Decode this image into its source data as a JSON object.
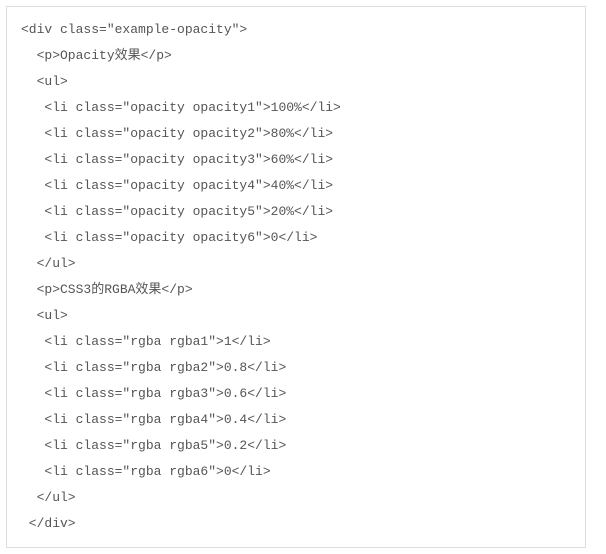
{
  "code": {
    "lines": [
      "<div class=\"example-opacity\">",
      "  <p>Opacity效果</p>",
      "  <ul>",
      "   <li class=\"opacity opacity1\">100%</li>",
      "   <li class=\"opacity opacity2\">80%</li>",
      "   <li class=\"opacity opacity3\">60%</li>",
      "   <li class=\"opacity opacity4\">40%</li>",
      "   <li class=\"opacity opacity5\">20%</li>",
      "   <li class=\"opacity opacity6\">0</li>",
      "  </ul>",
      "  <p>CSS3的RGBA效果</p>",
      "  <ul>",
      "   <li class=\"rgba rgba1\">1</li>",
      "   <li class=\"rgba rgba2\">0.8</li>",
      "   <li class=\"rgba rgba3\">0.6</li>",
      "   <li class=\"rgba rgba4\">0.4</li>",
      "   <li class=\"rgba rgba5\">0.2</li>",
      "   <li class=\"rgba rgba6\">0</li>",
      "  </ul>",
      " </div>"
    ]
  }
}
